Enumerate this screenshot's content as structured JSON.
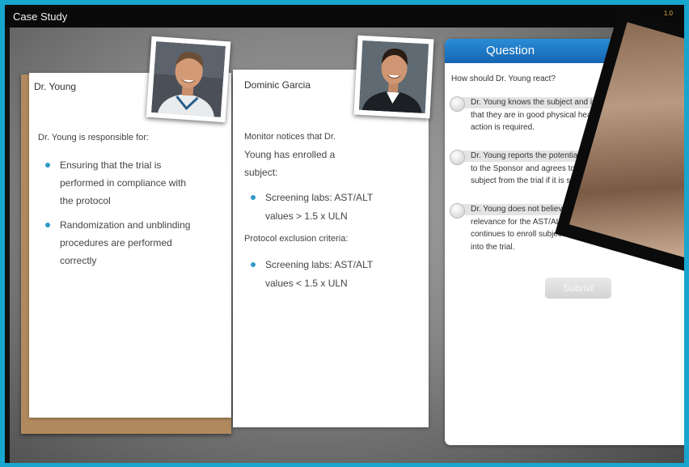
{
  "header": {
    "title": "Case Study",
    "page_indicator": "1.0"
  },
  "card_young": {
    "name": "Dr. Young",
    "intro": "Dr. Young is responsible for:",
    "bullets": [
      [
        "Ensuring that the trial is",
        "performed in compliance with",
        "the protocol"
      ],
      [
        "Randomization and unblinding",
        "procedures are performed",
        "correctly"
      ]
    ],
    "photo_icon": "portrait-photo"
  },
  "card_garcia": {
    "name": "Dominic Garcia",
    "notice": [
      "Monitor notices that Dr.",
      "Young has enrolled a",
      "subject:"
    ],
    "bullet1": [
      "Screening labs: AST/ALT",
      "values > 1.5 x ULN"
    ],
    "criteria_label": "Protocol exclusion criteria:",
    "bullet2": [
      "Screening labs: AST/ALT",
      "values < 1.5 x ULN"
    ],
    "photo_icon": "portrait-photo"
  },
  "question": {
    "header": "Question",
    "prompt": "How should Dr. Young react?",
    "options": [
      [
        "Dr. Young knows the subject and is",
        "that they are in good physical health",
        "action is required."
      ],
      [
        "Dr. Young reports the potential s",
        "to the Sponsor and agrees to w",
        "subject from the trial if it is so"
      ],
      [
        "Dr. Young does not believe",
        "relevance for the AST/ALT crit",
        "continues to enroll subjects with high",
        "into the trial."
      ]
    ],
    "submit_label": "Submit"
  },
  "colors": {
    "accent_blue": "#1f7fca",
    "cork": "#b08a5e",
    "bullet": "#2f9ac8"
  }
}
